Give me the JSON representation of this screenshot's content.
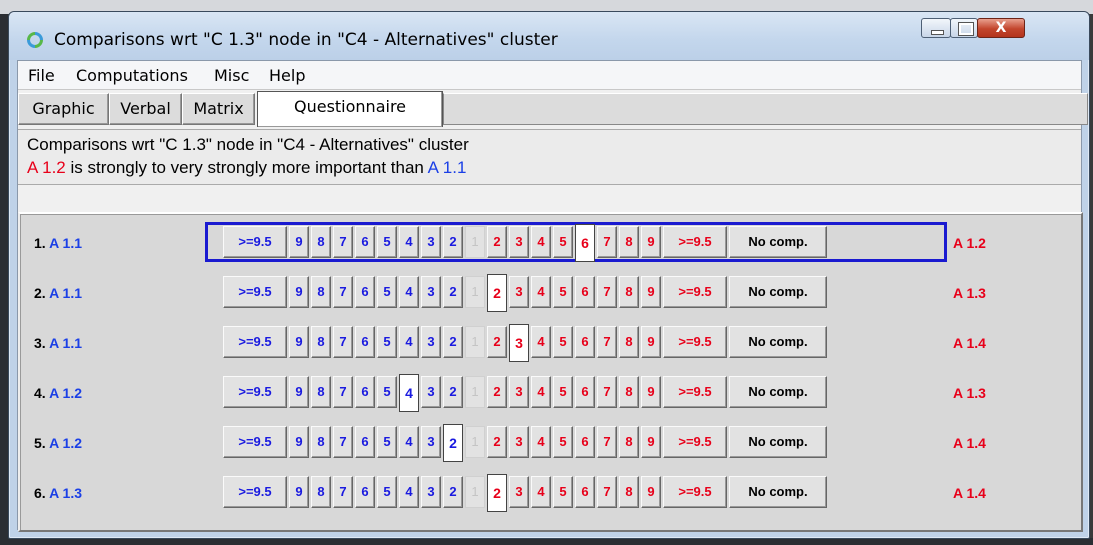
{
  "window": {
    "title": "Comparisons wrt \"C 1.3\" node in \"C4 - Alternatives\" cluster",
    "close_glyph": "X"
  },
  "menu": [
    "File",
    "Computations",
    "Misc",
    "Help"
  ],
  "tabs": [
    {
      "label": "Graphic",
      "active": false
    },
    {
      "label": "Verbal",
      "active": false
    },
    {
      "label": "Matrix",
      "active": false
    },
    {
      "label": "Questionnaire",
      "active": true
    }
  ],
  "header": {
    "line1": "Comparisons wrt \"C 1.3\" node in \"C4 - Alternatives\" cluster",
    "verdict_left": "A 1.2",
    "verdict_text": " is strongly to very strongly more important than ",
    "verdict_right": "A 1.1"
  },
  "scale": {
    "cells": [
      ">=9.5",
      "9",
      "8",
      "7",
      "6",
      "5",
      "4",
      "3",
      "2",
      "1",
      "2",
      "3",
      "4",
      "5",
      "6",
      "7",
      "8",
      "9",
      ">=9.5",
      "No comp."
    ]
  },
  "rows": [
    {
      "num": "1.",
      "left": "A 1.1",
      "right": "A 1.2",
      "selected_index": 14,
      "focused": true
    },
    {
      "num": "2.",
      "left": "A 1.1",
      "right": "A 1.3",
      "selected_index": 10,
      "focused": false
    },
    {
      "num": "3.",
      "left": "A 1.1",
      "right": "A 1.4",
      "selected_index": 11,
      "focused": false
    },
    {
      "num": "4.",
      "left": "A 1.2",
      "right": "A 1.3",
      "selected_index": 6,
      "focused": false
    },
    {
      "num": "5.",
      "left": "A 1.2",
      "right": "A 1.4",
      "selected_index": 8,
      "focused": false
    },
    {
      "num": "6.",
      "left": "A 1.3",
      "right": "A 1.4",
      "selected_index": 10,
      "focused": false
    }
  ],
  "colors": {
    "left_side": "#1a1ae0",
    "right_side": "#e8001a",
    "focus_frame": "#1a1ad0"
  }
}
